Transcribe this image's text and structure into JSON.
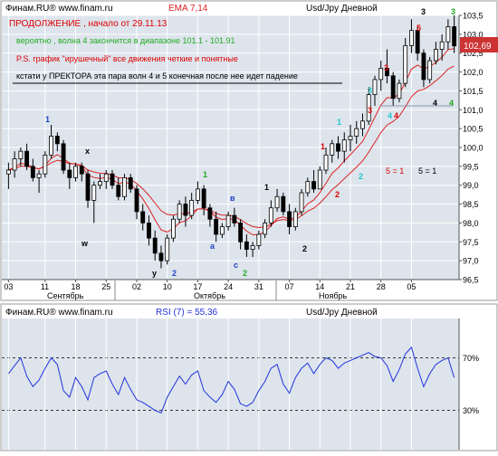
{
  "colors": {
    "bg": "#ffffff",
    "plot_bg": "#dde4ec",
    "grid": "#ffffff",
    "price_box": "#cc3333",
    "ema": "#dd2222",
    "rsi": "#2233dd",
    "label_red": "#dd0000",
    "label_green": "#22aa22",
    "label_blue": "#2244cc",
    "label_cyan": "#22c6cc",
    "label_black": "#000000"
  },
  "price_panel": {
    "header_left": "Финам.RU® www.finam.ru",
    "header_center": "EMA 7,14",
    "header_right": "Usd/Jpy Дневной",
    "last_price": "102,69",
    "annotations": [
      {
        "text": "ПРОДОЛЖЕНИЕ , начало от 29.11.13",
        "color": "#dd0000"
      },
      {
        "text": "вероятно , волна 4 закончится в диапазоне 101.1 - 101.91",
        "color": "#22aa22"
      },
      {
        "text": "P.S. график \"ирушечный\" все движения четкие и понятные",
        "color": "#dd0000"
      },
      {
        "text": "кстати у ПРЕКТОРА эта пара волн 4 и 5 конечная после нее идет падение",
        "color": "#000000"
      }
    ],
    "right_note_left": "5 = 1",
    "right_note_right": "5 = 1"
  },
  "rsi_panel": {
    "header_left": "Финам.RU® www.finam.ru",
    "header_center": "RSI (7) = 55,36",
    "header_right": "Usd/Jpy Дневной",
    "level_labels": [
      "70%",
      "30%"
    ]
  },
  "chart_data": {
    "type": "candlestick",
    "y_axis_labels": [
      "103,5",
      "103,0",
      "102,5",
      "102,0",
      "101,5",
      "101,0",
      "100,5",
      "100,0",
      "99,5",
      "99,0",
      "98,5",
      "98,0",
      "97,5",
      "97,0",
      "96,5"
    ],
    "ylim": [
      96.5,
      103.5
    ],
    "day_ticks": [
      "03",
      "11",
      "18",
      "25",
      "02",
      "10",
      "17",
      "24",
      "31",
      "07",
      "14",
      "21",
      "28",
      "05"
    ],
    "month_labels": [
      "Сентябрь",
      "Октябрь",
      "Ноябрь"
    ],
    "candles": [
      [
        99.3,
        99.6,
        98.9,
        99.4
      ],
      [
        99.4,
        99.9,
        99.2,
        99.7
      ],
      [
        99.7,
        100.0,
        99.5,
        99.9
      ],
      [
        99.9,
        100.1,
        99.4,
        99.5
      ],
      [
        99.5,
        99.7,
        99.1,
        99.2
      ],
      [
        99.2,
        99.4,
        98.8,
        99.3
      ],
      [
        99.3,
        99.9,
        99.2,
        99.8
      ],
      [
        99.8,
        100.6,
        99.7,
        100.3
      ],
      [
        100.3,
        100.4,
        99.9,
        100.1
      ],
      [
        100.1,
        100.2,
        99.3,
        99.4
      ],
      [
        99.4,
        99.6,
        98.9,
        99.2
      ],
      [
        99.2,
        99.6,
        99.1,
        99.5
      ],
      [
        99.5,
        99.6,
        99.1,
        99.3
      ],
      [
        99.3,
        99.4,
        98.4,
        98.6
      ],
      [
        98.6,
        99.1,
        98.0,
        99.0
      ],
      [
        99.0,
        99.3,
        98.9,
        99.1
      ],
      [
        99.1,
        99.4,
        98.9,
        99.3
      ],
      [
        99.3,
        99.4,
        98.9,
        99.0
      ],
      [
        99.0,
        99.2,
        98.6,
        98.7
      ],
      [
        98.7,
        99.3,
        98.6,
        99.2
      ],
      [
        99.2,
        99.3,
        98.8,
        98.9
      ],
      [
        98.9,
        99.0,
        98.1,
        98.3
      ],
      [
        98.3,
        98.5,
        97.8,
        98.0
      ],
      [
        98.0,
        98.2,
        97.4,
        97.6
      ],
      [
        97.6,
        97.8,
        97.0,
        97.2
      ],
      [
        97.2,
        97.4,
        96.8,
        97.0
      ],
      [
        97.0,
        97.7,
        96.9,
        97.6
      ],
      [
        97.6,
        98.2,
        97.5,
        98.1
      ],
      [
        98.1,
        98.6,
        98.0,
        98.5
      ],
      [
        98.5,
        98.7,
        97.9,
        98.2
      ],
      [
        98.2,
        98.8,
        98.1,
        98.6
      ],
      [
        98.6,
        99.1,
        98.5,
        98.9
      ],
      [
        98.9,
        99.0,
        98.2,
        98.4
      ],
      [
        98.4,
        98.5,
        97.9,
        98.1
      ],
      [
        98.1,
        98.3,
        97.5,
        97.7
      ],
      [
        97.7,
        98.0,
        97.6,
        97.9
      ],
      [
        97.9,
        98.3,
        97.8,
        98.2
      ],
      [
        98.2,
        98.4,
        97.9,
        98.0
      ],
      [
        98.0,
        98.1,
        97.3,
        97.5
      ],
      [
        97.5,
        97.7,
        97.1,
        97.3
      ],
      [
        97.3,
        97.5,
        97.1,
        97.4
      ],
      [
        97.4,
        97.8,
        97.3,
        97.7
      ],
      [
        97.7,
        98.1,
        97.6,
        98.0
      ],
      [
        98.0,
        98.6,
        97.9,
        98.4
      ],
      [
        98.4,
        98.9,
        98.3,
        98.7
      ],
      [
        98.7,
        98.8,
        98.2,
        98.3
      ],
      [
        98.3,
        98.5,
        97.7,
        97.9
      ],
      [
        97.9,
        98.4,
        97.8,
        98.3
      ],
      [
        98.3,
        98.9,
        98.2,
        98.8
      ],
      [
        98.8,
        99.2,
        98.7,
        99.1
      ],
      [
        99.1,
        99.4,
        98.8,
        98.9
      ],
      [
        98.9,
        99.5,
        98.9,
        99.4
      ],
      [
        99.4,
        100.0,
        99.3,
        99.8
      ],
      [
        99.8,
        100.2,
        99.6,
        100.1
      ],
      [
        100.1,
        100.3,
        99.7,
        99.9
      ],
      [
        99.9,
        100.4,
        99.6,
        100.2
      ],
      [
        100.2,
        100.6,
        99.9,
        100.3
      ],
      [
        100.3,
        100.7,
        100.1,
        100.5
      ],
      [
        100.5,
        100.9,
        100.3,
        100.7
      ],
      [
        100.7,
        101.6,
        100.6,
        101.4
      ],
      [
        101.4,
        101.9,
        101.1,
        101.8
      ],
      [
        101.8,
        102.3,
        101.5,
        102.1
      ],
      [
        102.1,
        102.6,
        101.7,
        101.9
      ],
      [
        101.9,
        102.0,
        101.1,
        101.3
      ],
      [
        101.3,
        101.8,
        101.2,
        101.7
      ],
      [
        101.7,
        102.9,
        101.6,
        102.7
      ],
      [
        102.7,
        103.4,
        102.5,
        103.1
      ],
      [
        103.1,
        103.2,
        102.3,
        102.5
      ],
      [
        102.5,
        102.6,
        101.6,
        101.8
      ],
      [
        101.8,
        102.4,
        101.7,
        102.3
      ],
      [
        102.3,
        102.8,
        102.2,
        102.6
      ],
      [
        102.6,
        103.0,
        102.3,
        102.8
      ],
      [
        102.8,
        103.4,
        102.6,
        103.2
      ],
      [
        103.2,
        103.5,
        102.5,
        102.69
      ]
    ],
    "rsi_levels": [
      30,
      70
    ],
    "rsi_values": [
      58,
      64,
      70,
      56,
      48,
      53,
      62,
      70,
      65,
      45,
      40,
      55,
      48,
      38,
      55,
      58,
      60,
      50,
      42,
      55,
      46,
      38,
      36,
      33,
      30,
      28,
      40,
      48,
      56,
      50,
      57,
      60,
      45,
      40,
      36,
      42,
      52,
      46,
      35,
      33,
      36,
      45,
      52,
      62,
      65,
      50,
      43,
      55,
      62,
      66,
      58,
      65,
      70,
      68,
      62,
      66,
      68,
      70,
      72,
      74,
      71,
      70,
      64,
      52,
      61,
      73,
      78,
      62,
      48,
      58,
      65,
      68,
      70,
      55
    ]
  }
}
